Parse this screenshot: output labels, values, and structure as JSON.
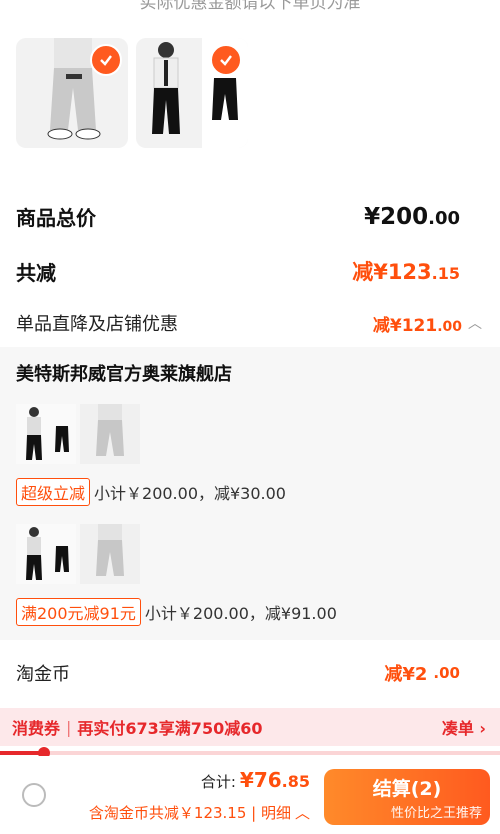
{
  "top_note": "实际优惠金额请以下单页为准",
  "items": [
    {
      "name": "grey-pants-item",
      "selected": true
    },
    {
      "name": "black-pants-item",
      "selected": true
    }
  ],
  "summary": {
    "total_label": "商品总价",
    "total_int": "¥200",
    "total_dec": ".00",
    "reduce_label": "共减",
    "reduce_int": "减¥123",
    "reduce_dec": ".15",
    "direct_label": "单品直降及店铺优惠",
    "direct_int": "减¥121",
    "direct_dec": ".00"
  },
  "store": {
    "name": "美特斯邦威官方奥莱旗舰店",
    "groups": [
      {
        "tag": "超级立减",
        "subtotal": "小计￥200.00，减¥30.00"
      },
      {
        "tag": "满200元减91元",
        "subtotal": "小计￥200.00，减¥91.00"
      }
    ]
  },
  "coin": {
    "label": "淘金币",
    "int": "减¥2",
    "dec": ".00"
  },
  "coupon": {
    "label": "消费券",
    "promo": "再实付673享满750减60",
    "action": "凑单",
    "progress": 0.09
  },
  "footer": {
    "total_label": "合计:",
    "total_int": "¥76",
    "total_dec": ".85",
    "detail": "含淘金币共减￥123.15 | 明细",
    "checkout": "结算(2)",
    "checkout_sub": "性价比之王推荐"
  },
  "colors": {
    "accent": "#ff4f0d",
    "coupon_red": "#e6282b"
  }
}
